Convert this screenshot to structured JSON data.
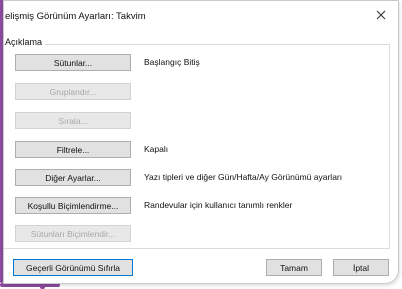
{
  "window": {
    "title": "elişmiş Görünüm Ayarları: Takvim",
    "close_icon": "close-icon"
  },
  "group": {
    "label": "Açıklama"
  },
  "rows": [
    {
      "button": "Sütunlar...",
      "enabled": true,
      "description": "Başlangıç Bitiş"
    },
    {
      "button": "Gruplandır...",
      "enabled": false,
      "description": ""
    },
    {
      "button": "Sırala...",
      "enabled": false,
      "description": ""
    },
    {
      "button": "Filtrele...",
      "enabled": true,
      "description": "Kapalı"
    },
    {
      "button": "Diğer Ayarlar...",
      "enabled": true,
      "description": "Yazı tipleri ve diğer Gün/Hafta/Ay Görünümü ayarları"
    },
    {
      "button": "Koşullu Biçimlendirme...",
      "enabled": true,
      "description": "Randevular için kullanıcı tanımlı renkler"
    },
    {
      "button": "Sütunları Biçimlendir...",
      "enabled": false,
      "description": ""
    }
  ],
  "footer": {
    "reset_label": "Geçerli Görünümü Sıfırla",
    "ok_label": "Tamam",
    "cancel_label": "İptal"
  },
  "colors": {
    "accent": "#8a4aa0",
    "focus": "#0078d7"
  }
}
